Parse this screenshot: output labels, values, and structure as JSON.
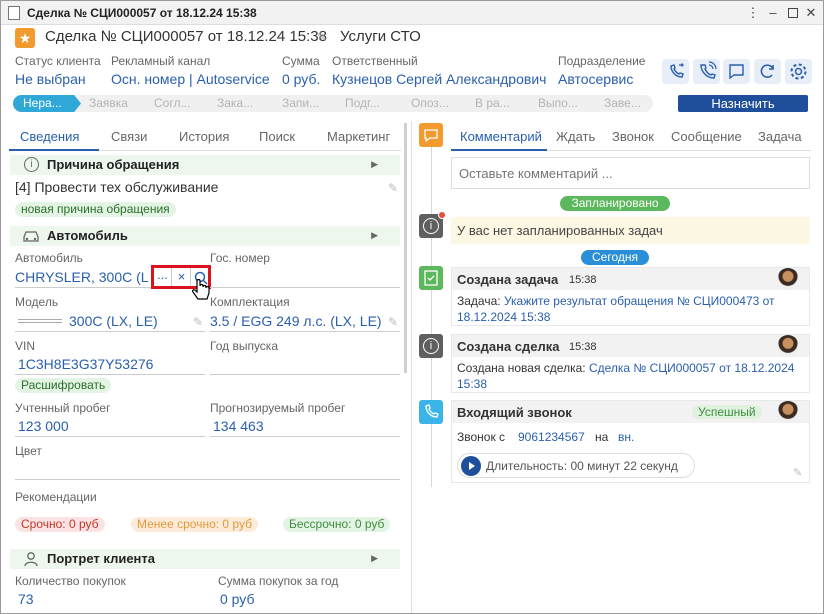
{
  "window": {
    "title": "Сделка № СЦИ000057 от 18.12.24 15:38"
  },
  "header": {
    "deal_title": "Сделка № СЦИ000057 от 18.12.24 15:38",
    "service": "Услуги СТО"
  },
  "info": {
    "client_status_label": "Статус клиента",
    "client_status_value": "Не выбран",
    "channel_label": "Рекламный канал",
    "channel_value": "Осн. номер | Autoservice",
    "sum_label": "Сумма",
    "sum_value": "0 руб.",
    "responsible_label": "Ответственный",
    "responsible_value": "Кузнецов Сергей Александрович",
    "division_label": "Подразделение",
    "division_value": "Автосервис"
  },
  "stages": [
    "Нера...",
    "Заявка",
    "Согл...",
    "Зака...",
    "Запи...",
    "Подг...",
    "Опоз...",
    "В ра...",
    "Выпо...",
    "Заве..."
  ],
  "assign_button": "Назначить",
  "left_tabs": [
    "Сведения",
    "Связи",
    "История",
    "Поиск",
    "Маркетинг"
  ],
  "reason": {
    "title": "Причина обращения",
    "value": "[4] Провести тех обслуживание",
    "new_reason_tag": "новая причина обращения"
  },
  "car": {
    "title": "Автомобиль",
    "car_label": "Автомобиль",
    "car_value": "CHRYSLER, 300C (L",
    "plate_label": "Гос. номер",
    "model_label": "Модель",
    "model_value": "300C (LX, LE)",
    "trim_label": "Комплектация",
    "trim_value": "3.5 / EGG 249 л.с. (LX, LE)",
    "vin_label": "VIN",
    "vin_value": "1C3H8E3G37Y53276",
    "year_label": "Год выпуска",
    "decode_tag": "Расшифровать",
    "mileage_label": "Учтенный пробег",
    "mileage_value": "123 000",
    "forecast_label": "Прогнозируемый пробег",
    "forecast_value": "134 463",
    "color_label": "Цвет",
    "recommend_label": "Рекомендации",
    "urgent": "Срочно: 0 руб",
    "less_urgent": "Менее срочно: 0 руб",
    "indefinite": "Бессрочно: 0 руб",
    "btn_more": "...",
    "btn_clear": "×"
  },
  "portrait": {
    "title": "Портрет клиента",
    "purchases_label": "Количество покупок",
    "purchases_value": "73",
    "year_sum_label": "Сумма покупок за год",
    "year_sum_value": "0 руб"
  },
  "right_tabs": [
    "Комментарий",
    "Ждать",
    "Звонок",
    "Сообщение",
    "Задача"
  ],
  "comment_placeholder": "Оставьте комментарий ...",
  "planned_badge": "Запланировано",
  "no_tasks": "У вас нет запланированных задач",
  "today_badge": "Сегодня",
  "feed": [
    {
      "title": "Создана задача",
      "time": "15:38",
      "prefix": "Задача: ",
      "link": "Укажите результат обращения № СЦИ000473 от 18.12.2024 15:38"
    },
    {
      "title": "Создана сделка",
      "time": "15:38",
      "prefix": "Создана новая сделка: ",
      "link": "Сделка № СЦИ000057 от 18.12.2024 15:38"
    },
    {
      "title": "Входящий звонок",
      "status": "Успешный",
      "call_prefix": "Звонок с",
      "phone": "9061234567",
      "on": "на",
      "on_link": "вн.",
      "duration": "Длительность: 00 минут 22 секунд"
    }
  ],
  "colors": {
    "accent": "#2a5fae",
    "orange": "#f29a2e",
    "green": "#5cb85c",
    "grey_icon": "#5f5f5f"
  }
}
